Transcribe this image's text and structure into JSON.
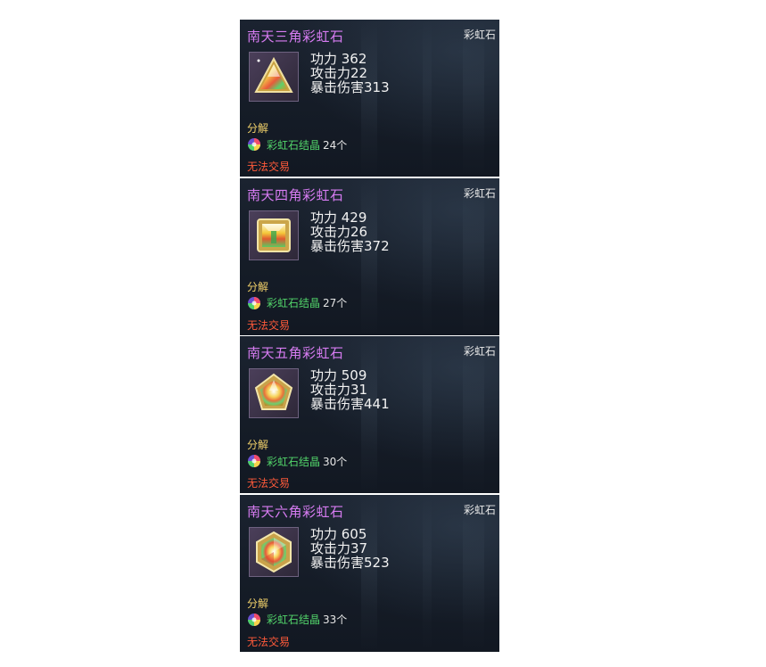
{
  "items": [
    {
      "name": "南天三角彩虹石",
      "category": "彩虹石",
      "icon": "triangle-gem-icon",
      "stats": [
        "功力 362",
        "攻击力22",
        "暴击伤害313"
      ],
      "decompose_label": "分解",
      "material": {
        "name": "彩虹石结晶",
        "count": "24个",
        "icon": "rainbow-crystal-icon"
      },
      "trade_status": "无法交易"
    },
    {
      "name": "南天四角彩虹石",
      "category": "彩虹石",
      "icon": "square-gem-icon",
      "stats": [
        "功力 429",
        "攻击力26",
        "暴击伤害372"
      ],
      "decompose_label": "分解",
      "material": {
        "name": "彩虹石结晶",
        "count": "27个",
        "icon": "rainbow-crystal-icon"
      },
      "trade_status": "无法交易"
    },
    {
      "name": "南天五角彩虹石",
      "category": "彩虹石",
      "icon": "pentagon-gem-icon",
      "stats": [
        "功力 509",
        "攻击力31",
        "暴击伤害441"
      ],
      "decompose_label": "分解",
      "material": {
        "name": "彩虹石结晶",
        "count": "30个",
        "icon": "rainbow-crystal-icon"
      },
      "trade_status": "无法交易"
    },
    {
      "name": "南天六角彩虹石",
      "category": "彩虹石",
      "icon": "hexagon-gem-icon",
      "stats": [
        "功力 605",
        "攻击力37",
        "暴击伤害523"
      ],
      "decompose_label": "分解",
      "material": {
        "name": "彩虹石结晶",
        "count": "33个",
        "icon": "rainbow-crystal-icon"
      },
      "trade_status": "无法交易"
    }
  ],
  "colors": {
    "title": "#d77cf2",
    "decompose": "#f0d06a",
    "material": "#52d46a",
    "untradeable": "#ff5a3a",
    "panel": "#161d28"
  }
}
